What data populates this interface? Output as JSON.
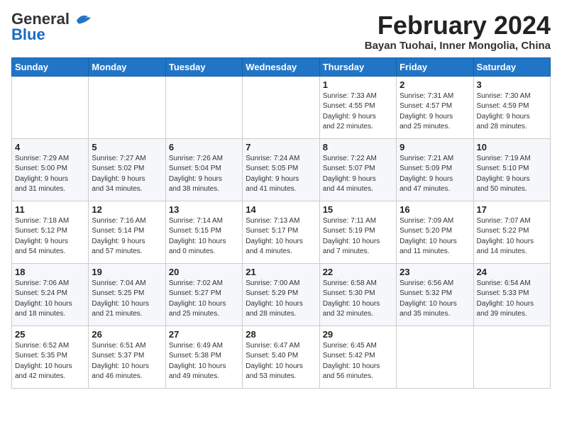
{
  "logo": {
    "general": "General",
    "blue": "Blue"
  },
  "title": "February 2024",
  "location": "Bayan Tuohai, Inner Mongolia, China",
  "weekdays": [
    "Sunday",
    "Monday",
    "Tuesday",
    "Wednesday",
    "Thursday",
    "Friday",
    "Saturday"
  ],
  "weeks": [
    [
      {
        "day": "",
        "info": ""
      },
      {
        "day": "",
        "info": ""
      },
      {
        "day": "",
        "info": ""
      },
      {
        "day": "",
        "info": ""
      },
      {
        "day": "1",
        "info": "Sunrise: 7:33 AM\nSunset: 4:55 PM\nDaylight: 9 hours\nand 22 minutes."
      },
      {
        "day": "2",
        "info": "Sunrise: 7:31 AM\nSunset: 4:57 PM\nDaylight: 9 hours\nand 25 minutes."
      },
      {
        "day": "3",
        "info": "Sunrise: 7:30 AM\nSunset: 4:59 PM\nDaylight: 9 hours\nand 28 minutes."
      }
    ],
    [
      {
        "day": "4",
        "info": "Sunrise: 7:29 AM\nSunset: 5:00 PM\nDaylight: 9 hours\nand 31 minutes."
      },
      {
        "day": "5",
        "info": "Sunrise: 7:27 AM\nSunset: 5:02 PM\nDaylight: 9 hours\nand 34 minutes."
      },
      {
        "day": "6",
        "info": "Sunrise: 7:26 AM\nSunset: 5:04 PM\nDaylight: 9 hours\nand 38 minutes."
      },
      {
        "day": "7",
        "info": "Sunrise: 7:24 AM\nSunset: 5:05 PM\nDaylight: 9 hours\nand 41 minutes."
      },
      {
        "day": "8",
        "info": "Sunrise: 7:22 AM\nSunset: 5:07 PM\nDaylight: 9 hours\nand 44 minutes."
      },
      {
        "day": "9",
        "info": "Sunrise: 7:21 AM\nSunset: 5:09 PM\nDaylight: 9 hours\nand 47 minutes."
      },
      {
        "day": "10",
        "info": "Sunrise: 7:19 AM\nSunset: 5:10 PM\nDaylight: 9 hours\nand 50 minutes."
      }
    ],
    [
      {
        "day": "11",
        "info": "Sunrise: 7:18 AM\nSunset: 5:12 PM\nDaylight: 9 hours\nand 54 minutes."
      },
      {
        "day": "12",
        "info": "Sunrise: 7:16 AM\nSunset: 5:14 PM\nDaylight: 9 hours\nand 57 minutes."
      },
      {
        "day": "13",
        "info": "Sunrise: 7:14 AM\nSunset: 5:15 PM\nDaylight: 10 hours\nand 0 minutes."
      },
      {
        "day": "14",
        "info": "Sunrise: 7:13 AM\nSunset: 5:17 PM\nDaylight: 10 hours\nand 4 minutes."
      },
      {
        "day": "15",
        "info": "Sunrise: 7:11 AM\nSunset: 5:19 PM\nDaylight: 10 hours\nand 7 minutes."
      },
      {
        "day": "16",
        "info": "Sunrise: 7:09 AM\nSunset: 5:20 PM\nDaylight: 10 hours\nand 11 minutes."
      },
      {
        "day": "17",
        "info": "Sunrise: 7:07 AM\nSunset: 5:22 PM\nDaylight: 10 hours\nand 14 minutes."
      }
    ],
    [
      {
        "day": "18",
        "info": "Sunrise: 7:06 AM\nSunset: 5:24 PM\nDaylight: 10 hours\nand 18 minutes."
      },
      {
        "day": "19",
        "info": "Sunrise: 7:04 AM\nSunset: 5:25 PM\nDaylight: 10 hours\nand 21 minutes."
      },
      {
        "day": "20",
        "info": "Sunrise: 7:02 AM\nSunset: 5:27 PM\nDaylight: 10 hours\nand 25 minutes."
      },
      {
        "day": "21",
        "info": "Sunrise: 7:00 AM\nSunset: 5:29 PM\nDaylight: 10 hours\nand 28 minutes."
      },
      {
        "day": "22",
        "info": "Sunrise: 6:58 AM\nSunset: 5:30 PM\nDaylight: 10 hours\nand 32 minutes."
      },
      {
        "day": "23",
        "info": "Sunrise: 6:56 AM\nSunset: 5:32 PM\nDaylight: 10 hours\nand 35 minutes."
      },
      {
        "day": "24",
        "info": "Sunrise: 6:54 AM\nSunset: 5:33 PM\nDaylight: 10 hours\nand 39 minutes."
      }
    ],
    [
      {
        "day": "25",
        "info": "Sunrise: 6:52 AM\nSunset: 5:35 PM\nDaylight: 10 hours\nand 42 minutes."
      },
      {
        "day": "26",
        "info": "Sunrise: 6:51 AM\nSunset: 5:37 PM\nDaylight: 10 hours\nand 46 minutes."
      },
      {
        "day": "27",
        "info": "Sunrise: 6:49 AM\nSunset: 5:38 PM\nDaylight: 10 hours\nand 49 minutes."
      },
      {
        "day": "28",
        "info": "Sunrise: 6:47 AM\nSunset: 5:40 PM\nDaylight: 10 hours\nand 53 minutes."
      },
      {
        "day": "29",
        "info": "Sunrise: 6:45 AM\nSunset: 5:42 PM\nDaylight: 10 hours\nand 56 minutes."
      },
      {
        "day": "",
        "info": ""
      },
      {
        "day": "",
        "info": ""
      }
    ]
  ]
}
